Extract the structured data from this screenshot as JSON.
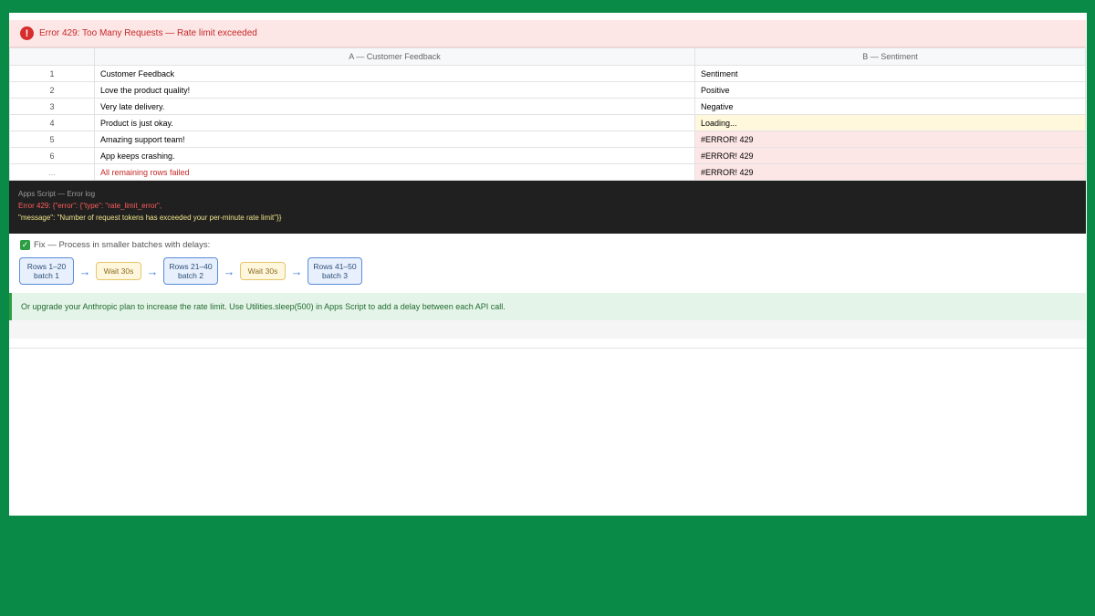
{
  "error_banner": {
    "text": "Error 429: Too Many Requests — Rate limit exceeded"
  },
  "sheet": {
    "columns": [
      "A — Customer Feedback",
      "B — Sentiment"
    ],
    "rows": [
      {
        "num": "1",
        "a": "Customer Feedback",
        "b": "Sentiment"
      },
      {
        "num": "2",
        "a": "Love the product quality!",
        "b": "Positive"
      },
      {
        "num": "3",
        "a": "Very late delivery.",
        "b": "Negative"
      },
      {
        "num": "4",
        "a": "Product is just okay.",
        "b": "Loading..."
      },
      {
        "num": "5",
        "a": "Amazing support team!",
        "b": "#ERROR! 429"
      },
      {
        "num": "6",
        "a": "App keeps crashing.",
        "b": "#ERROR! 429"
      },
      {
        "num": "...",
        "a": "All remaining rows failed",
        "b": "#ERROR! 429"
      }
    ]
  },
  "log": {
    "title": "Apps Script — Error log",
    "line1": "Error 429: {\"error\": {\"type\": \"rate_limit_error\",",
    "line2": "\"message\": \"Number of request tokens has exceeded your per-minute rate limit\"}}"
  },
  "fix": {
    "label": "Fix — Process in smaller batches with delays:",
    "steps": [
      {
        "title": "Rows 1–20",
        "sub": "batch 1"
      },
      {
        "wait": "Wait 30s"
      },
      {
        "title": "Rows 21–40",
        "sub": "batch 2"
      },
      {
        "wait": "Wait 30s"
      },
      {
        "title": "Rows 41–50",
        "sub": "batch 3"
      }
    ],
    "arrow": "→"
  },
  "note": "Or upgrade your Anthropic plan to increase the rate limit. Use Utilities.sleep(500) in Apps Script to add a delay between each API call.",
  "colors": {
    "background": "#0a8a47",
    "error_red": "#c62828",
    "loading_bg": "#fff8dc",
    "error_bg": "#fde6e6",
    "note_green": "#1f6b2f"
  }
}
